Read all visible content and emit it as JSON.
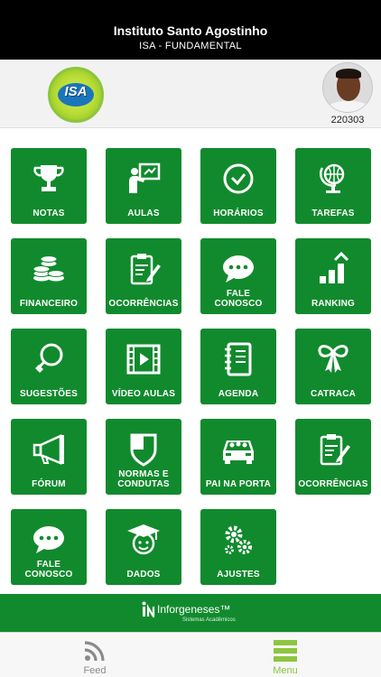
{
  "header": {
    "title": "Instituto Santo Agostinho",
    "subtitle": "ISA - FUNDAMENTAL"
  },
  "profile": {
    "logo_text": "ISA",
    "student_id": "220303"
  },
  "menu": {
    "notas": "NOTAS",
    "aulas": "AULAS",
    "horarios": "HORÁRIOS",
    "tarefas": "TAREFAS",
    "financeiro": "FINANCEIRO",
    "ocorrencias": "OCORRÊNCIAS",
    "fale_conosco": "FALE CONOSCO",
    "ranking": "RANKING",
    "sugestoes": "SUGESTÕES",
    "video_aulas": "VÍDEO AULAS",
    "agenda": "AGENDA",
    "catraca": "CATRACA",
    "forum": "FÓRUM",
    "normas_condutas": "NORMAS E CONDUTAS",
    "pai_na_porta": "PAI NA PORTA",
    "ocorrencias_2": "OCORRÊNCIAS",
    "fale_conosco_2": "FALE CONOSCO",
    "dados": "DADOS",
    "ajustes": "AJUSTES"
  },
  "footer": {
    "brand_name": "Inforgeneses™",
    "brand_tagline": "Sistemas Acadêmicos"
  },
  "tabbar": {
    "feed_label": "Feed",
    "menu_label": "Menu"
  },
  "colors": {
    "tile_green": "#118a2d",
    "active_tab": "#8cc63f",
    "header_bg": "#000000"
  }
}
